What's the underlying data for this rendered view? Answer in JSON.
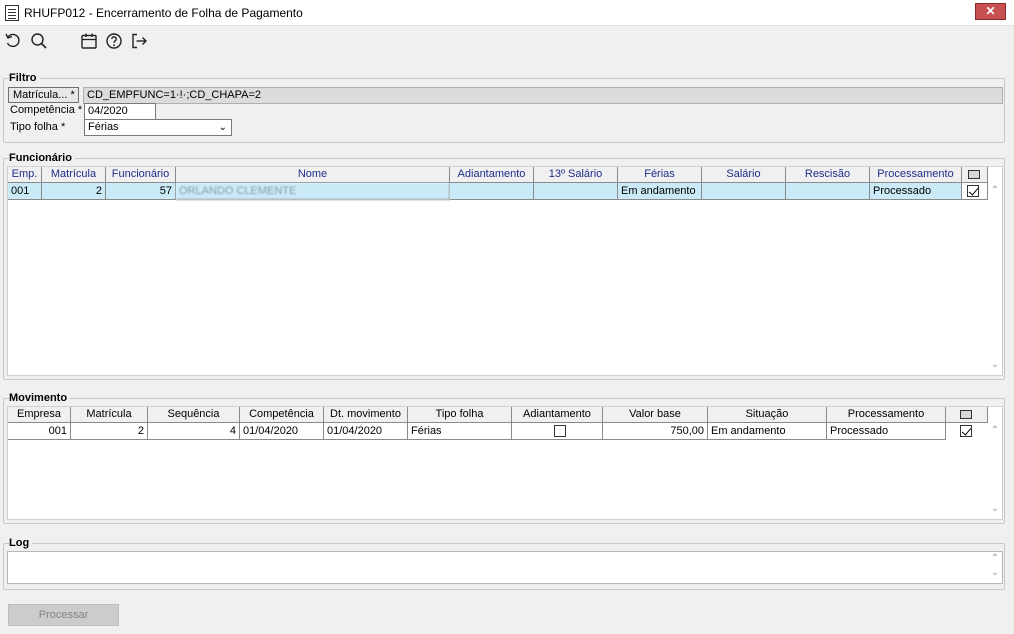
{
  "window": {
    "title": "RHUFP012 - Encerramento de Folha de Pagamento",
    "close_label": "✕"
  },
  "toolbar": {
    "icons": [
      "undo-icon",
      "search-icon",
      "calendar-icon",
      "help-icon",
      "exit-icon"
    ]
  },
  "filtro": {
    "title": "Filtro",
    "matricula_button": "Matrícula... *",
    "matricula_value": "CD_EMPFUNC=1·!·;CD_CHAPA=2",
    "competencia_label": "Competência *",
    "competencia_value": "04/2020",
    "tipo_folha_label": "Tipo folha *",
    "tipo_folha_value": "Férias"
  },
  "funcionario": {
    "title": "Funcionário",
    "columns": [
      "Emp.",
      "Matrícula",
      "Funcionário",
      "Nome",
      "Adiantamento",
      "13º Salário",
      "Férias",
      "Salário",
      "Rescisão",
      "Processamento"
    ],
    "rows": [
      {
        "emp": "001",
        "matricula": "2",
        "funcionario": "57",
        "nome": "ORLANDO CLEMENTE",
        "adiantamento": "",
        "decimo": "",
        "ferias": "Em andamento",
        "salario": "",
        "rescisao": "",
        "processamento": "Processado",
        "checked": true
      }
    ]
  },
  "movimento": {
    "title": "Movimento",
    "columns": [
      "Empresa",
      "Matrícula",
      "Sequência",
      "Competência",
      "Dt. movimento",
      "Tipo folha",
      "Adiantamento",
      "Valor base",
      "Situação",
      "Processamento"
    ],
    "rows": [
      {
        "empresa": "001",
        "matricula": "2",
        "sequencia": "4",
        "competencia": "01/04/2020",
        "dt_movimento": "01/04/2020",
        "tipo_folha": "Férias",
        "adiantamento": false,
        "valor_base": "750,00",
        "situacao": "Em andamento",
        "processamento": "Processado",
        "checked": true
      }
    ]
  },
  "log": {
    "title": "Log",
    "value": ""
  },
  "actions": {
    "processar": "Processar"
  }
}
